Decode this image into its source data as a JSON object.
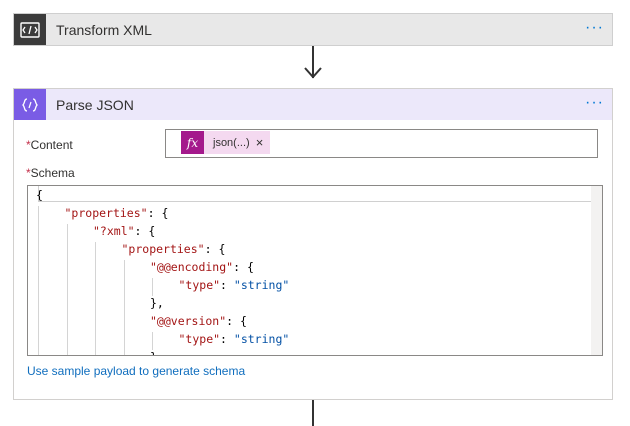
{
  "steps": [
    {
      "title": "Transform XML",
      "icon": "transform-xml-icon",
      "menu": "···"
    },
    {
      "title": "Parse JSON",
      "icon": "braces-icon",
      "menu": "···"
    }
  ],
  "parse_json": {
    "content_label": "Content",
    "required_mark": "*",
    "content_token": {
      "fx": "fx",
      "name": "json(...)",
      "remove": "×"
    },
    "schema_label": "Schema",
    "schema_lines": [
      {
        "indent": 0,
        "parts": [
          {
            "t": "{",
            "c": "p"
          }
        ]
      },
      {
        "indent": 1,
        "parts": [
          {
            "t": "\"properties\"",
            "c": "k"
          },
          {
            "t": ": {",
            "c": "p"
          }
        ]
      },
      {
        "indent": 2,
        "parts": [
          {
            "t": "\"?xml\"",
            "c": "k"
          },
          {
            "t": ": {",
            "c": "p"
          }
        ]
      },
      {
        "indent": 3,
        "parts": [
          {
            "t": "\"properties\"",
            "c": "k"
          },
          {
            "t": ": {",
            "c": "p"
          }
        ]
      },
      {
        "indent": 4,
        "parts": [
          {
            "t": "\"@@encoding\"",
            "c": "k"
          },
          {
            "t": ": {",
            "c": "p"
          }
        ]
      },
      {
        "indent": 5,
        "parts": [
          {
            "t": "\"type\"",
            "c": "k"
          },
          {
            "t": ": ",
            "c": "p"
          },
          {
            "t": "\"string\"",
            "c": "s"
          }
        ]
      },
      {
        "indent": 4,
        "parts": [
          {
            "t": "},",
            "c": "p"
          }
        ]
      },
      {
        "indent": 4,
        "parts": [
          {
            "t": "\"@@version\"",
            "c": "k"
          },
          {
            "t": ": {",
            "c": "p"
          }
        ]
      },
      {
        "indent": 5,
        "parts": [
          {
            "t": "\"type\"",
            "c": "k"
          },
          {
            "t": ": ",
            "c": "p"
          },
          {
            "t": "\"string\"",
            "c": "s"
          }
        ]
      },
      {
        "indent": 4,
        "parts": [
          {
            "t": "}",
            "c": "p"
          }
        ]
      }
    ],
    "sample_link": "Use sample payload to generate schema"
  }
}
